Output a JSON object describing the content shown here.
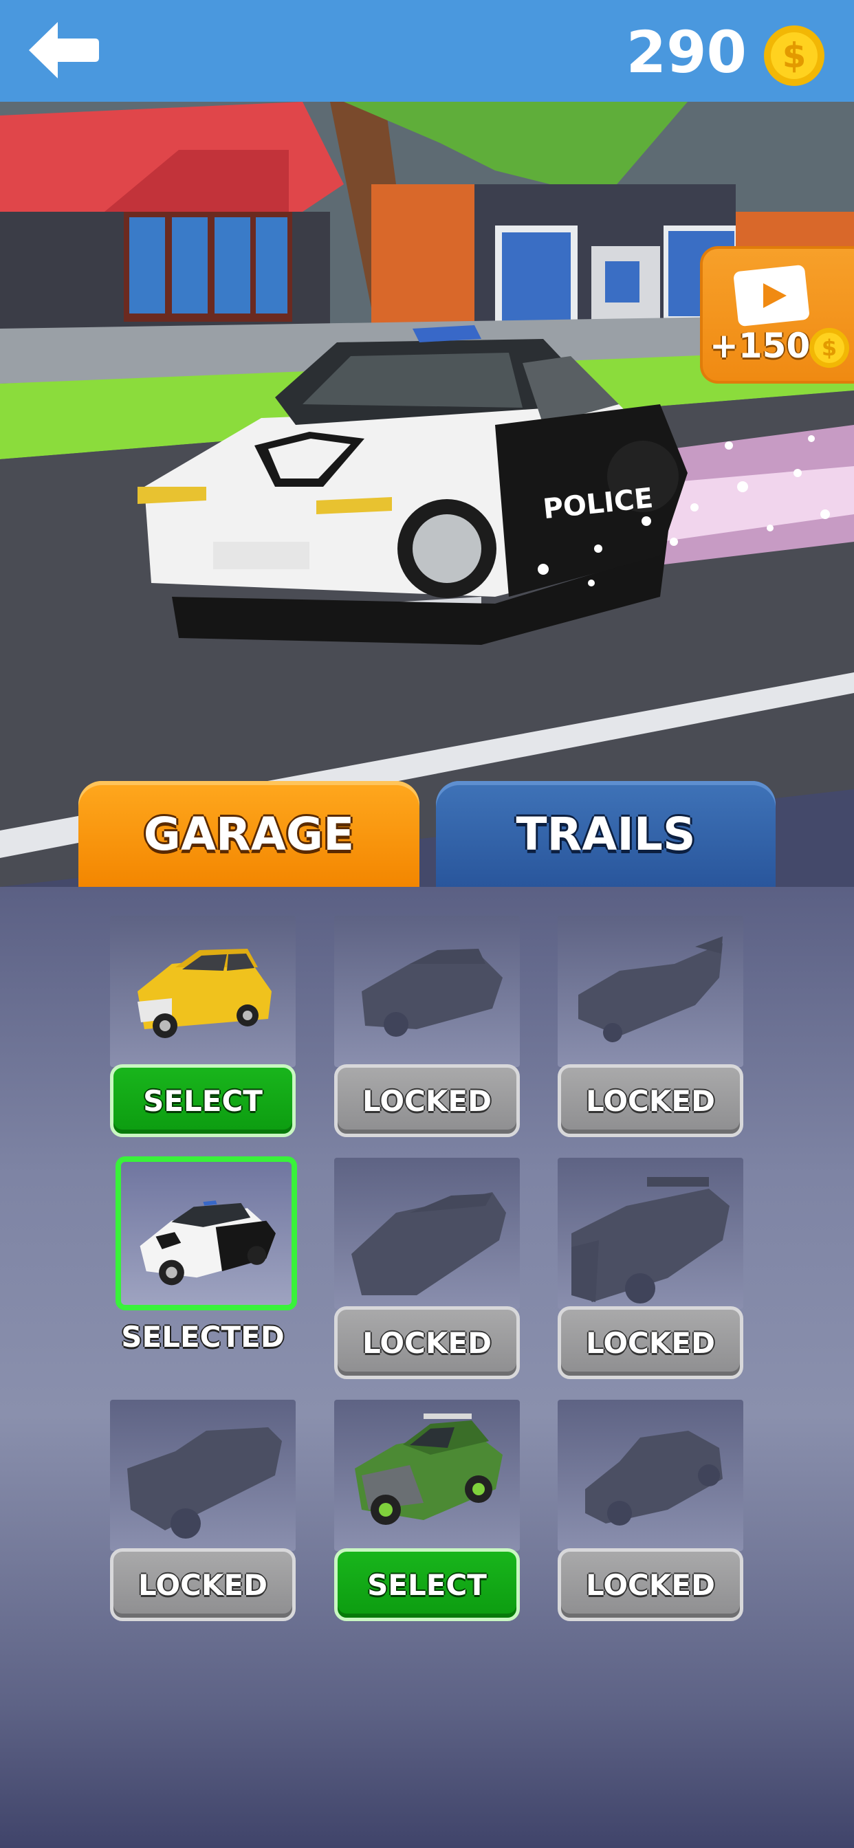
{
  "header": {
    "back_icon": "arrow-left-icon",
    "coins": "290",
    "coin_icon": "dollar-coin-icon"
  },
  "scene": {
    "car_door_text": "POLICE",
    "ad_reward": {
      "label": "+150",
      "video_icon": "play-video-icon",
      "coin_icon": "dollar-coin-icon"
    }
  },
  "tabs": [
    {
      "label": "GARAGE",
      "active": true
    },
    {
      "label": "TRAILS",
      "active": false
    }
  ],
  "garage": {
    "cars": [
      {
        "state": "select",
        "label": "SELECT",
        "car": "yellow-hatchback"
      },
      {
        "state": "locked",
        "label": "LOCKED",
        "car": "silhouette-sedan"
      },
      {
        "state": "locked",
        "label": "LOCKED",
        "car": "silhouette-batmobile"
      },
      {
        "state": "selected",
        "label": "SELECTED",
        "car": "police-car"
      },
      {
        "state": "locked",
        "label": "LOCKED",
        "car": "silhouette-sports"
      },
      {
        "state": "locked",
        "label": "LOCKED",
        "car": "silhouette-truck"
      },
      {
        "state": "locked",
        "label": "LOCKED",
        "car": "silhouette-pickup"
      },
      {
        "state": "select",
        "label": "SELECT",
        "car": "green-offroader"
      },
      {
        "state": "locked",
        "label": "LOCKED",
        "car": "silhouette-beetle"
      }
    ]
  },
  "colors": {
    "header_bar": "#4a98de",
    "tab_active": "#f38600",
    "tab_inactive": "#29569c",
    "select_green": "#0c9c10",
    "locked_gray": "#8e8e90",
    "selected_outline": "#39f23a"
  }
}
